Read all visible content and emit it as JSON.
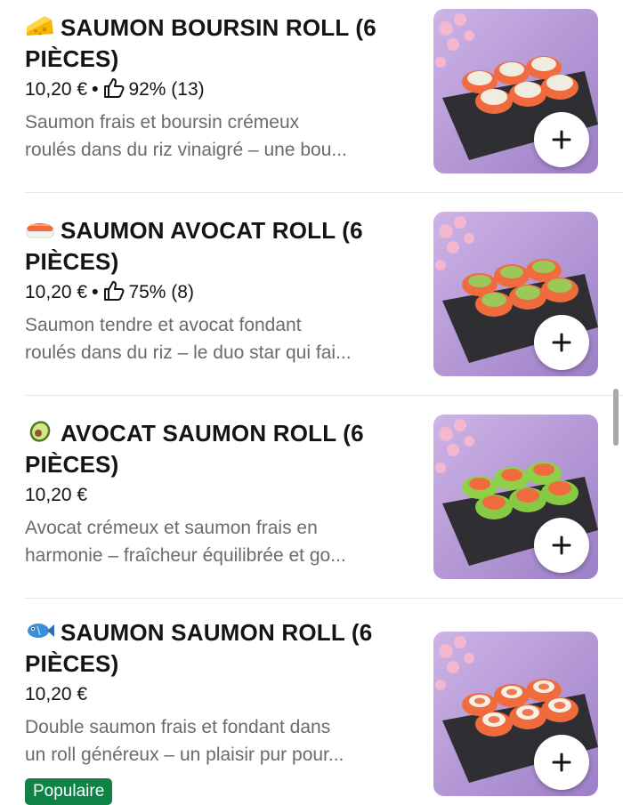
{
  "items": [
    {
      "emoji_icon": "cheese-icon",
      "title_line1": "SAUMON BOURSIN ROLL (6",
      "title_line2": "PIÈCES)",
      "price": "10,20 €",
      "rating": "92% (13)",
      "desc_line1": "Saumon frais et boursin crémeux",
      "desc_line2": "roulés dans du riz vinaigré – une bou...",
      "roll_style": "salmon-cheese"
    },
    {
      "emoji_icon": "sushi-icon",
      "title_line1": "SAUMON AVOCAT ROLL (6",
      "title_line2": "PIÈCES)",
      "price": "10,20 €",
      "rating": "75% (8)",
      "desc_line1": "Saumon tendre et avocat fondant",
      "desc_line2": "roulés dans du riz – le duo star qui fai...",
      "roll_style": "salmon-avocado"
    },
    {
      "emoji_icon": "avocado-icon",
      "title_line1": "AVOCAT SAUMON ROLL (6",
      "title_line2": "PIÈCES)",
      "price": "10,20 €",
      "desc_line1": "Avocat crémeux et saumon frais en",
      "desc_line2": "harmonie – fraîcheur équilibrée et go...",
      "roll_style": "avocado-salmon"
    },
    {
      "emoji_icon": "fish-icon",
      "title_line1": "SAUMON SAUMON ROLL (6",
      "title_line2": "PIÈCES)",
      "price": "10,20 €",
      "desc_line1": "Double saumon frais et fondant dans",
      "desc_line2": "un roll généreux – un plaisir pur pour...",
      "badge": "Populaire",
      "roll_style": "salmon-salmon"
    }
  ],
  "colors": {
    "text": "#141414",
    "description": "#6b6b6b",
    "badge_bg": "#0e8345",
    "thumb_bg": "#b79ad6"
  }
}
